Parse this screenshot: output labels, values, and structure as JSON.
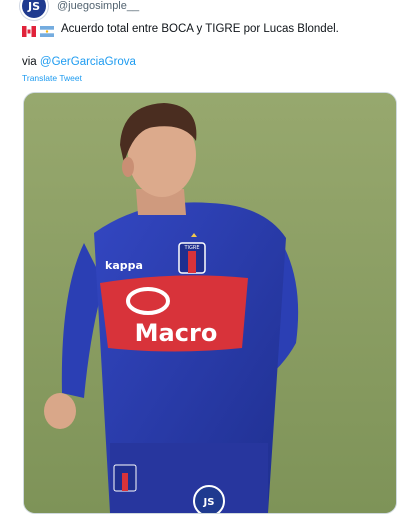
{
  "account": {
    "avatar_text": "JS",
    "handle": "@juegosimple__"
  },
  "tweet": {
    "text": "Acuerdo total entre BOCA y TIGRE por Lucas Blondel.",
    "via_label": "via",
    "via_handle": "@GerGarciaGrova",
    "translate_label": "Translate Tweet"
  },
  "media": {
    "photo": "Football player in blue Tigre kit with red chest band",
    "shirt_brand": "kappa",
    "shirt_sponsor": "Macro",
    "club_crest": "TIGRE",
    "watermark_text": "JS"
  },
  "colors": {
    "link": "#1d9bf0",
    "kit_blue": "#2a3fb0",
    "kit_red": "#d8333a",
    "pitch_green": "#8b9e63"
  }
}
